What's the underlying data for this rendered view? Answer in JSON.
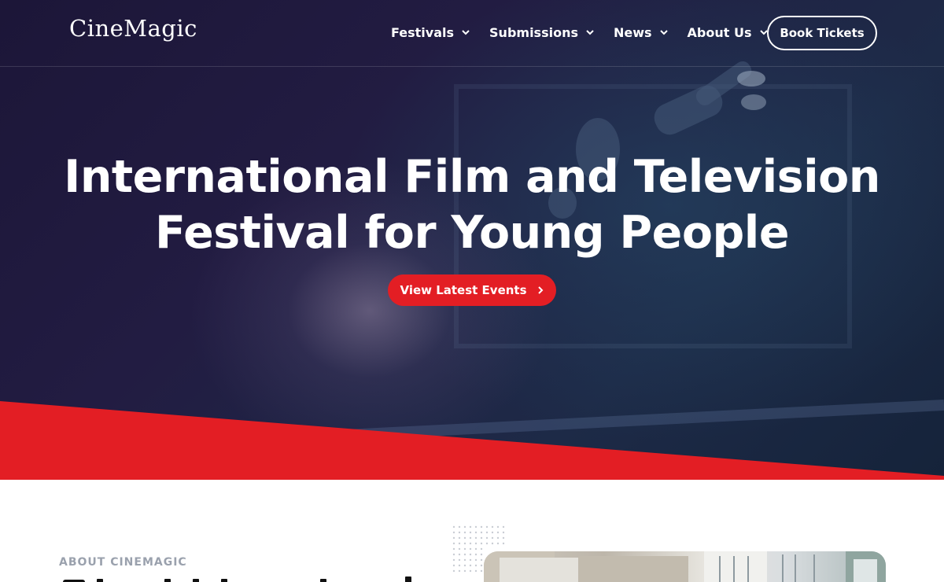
{
  "header": {
    "logo_text": "CineMagic",
    "nav": [
      {
        "label": "Festivals",
        "has_dropdown": true
      },
      {
        "label": "Submissions",
        "has_dropdown": true
      },
      {
        "label": "News",
        "has_dropdown": true
      },
      {
        "label": "About Us",
        "has_dropdown": true
      }
    ],
    "cta_label": "Book Tickets"
  },
  "hero": {
    "title_line1": "International Film and Television",
    "title_line2": "Festival for Young People",
    "button_label": "View Latest Events"
  },
  "about": {
    "eyebrow": "ABOUT CINEMAGIC"
  },
  "colors": {
    "accent_red": "#e31e24",
    "hero_dark": "#1c1638",
    "white": "#ffffff"
  },
  "icons": {
    "nav_dropdown": "chevron-down-icon",
    "button_arrow": "chevron-right-icon"
  }
}
